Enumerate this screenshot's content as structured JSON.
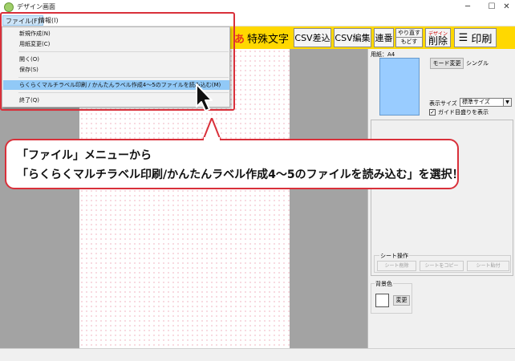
{
  "window": {
    "title": "デザイン画面",
    "minimize": "─",
    "maximize": "☐",
    "close": "✕"
  },
  "menubar": {
    "file": "ファイル(F)",
    "info": "情報(I)"
  },
  "file_menu": {
    "items": [
      "新規作成(N)",
      "用紙変更(C)",
      "開く(O)",
      "保存(S)",
      "らくらくマルチラベル印刷 / かんたんラベル作成4～5のファイルを読み込む(M)",
      "終了(Q)"
    ]
  },
  "toolbar": {
    "special_char": "特殊文字",
    "csv_insert": "CSV差込",
    "csv_edit": "CSV編集",
    "serial": "連番",
    "redo": "やり直す",
    "undo": "もどす",
    "delete_small": "デザイン",
    "delete": "削除",
    "print": "印刷"
  },
  "right_panel": {
    "paper_label": "用紙：A4",
    "mode_button": "モード変更",
    "mode_value": "シングル",
    "display_size_label": "表示サイズ",
    "display_size_value": "標準サイズ",
    "guide_label": "ガイド目盛りを表示",
    "guide_checked": true,
    "sheet_ops_title": "シート操作",
    "sheet_delete": "シート削除",
    "sheet_copy": "シートをコピー",
    "sheet_paste": "シート貼付",
    "bg_title": "背景色",
    "bg_change": "変更"
  },
  "callout": {
    "line1": "「ファイル」メニューから",
    "line2": "「らくらくマルチラベル印刷/かんたんラベル作成4～5のファイルを読み込む」を選択！"
  },
  "colors": {
    "toolbar": "#ffd800",
    "highlight": "#91c9f7",
    "accent_red": "#d9303a",
    "preview": "#99ccff"
  }
}
